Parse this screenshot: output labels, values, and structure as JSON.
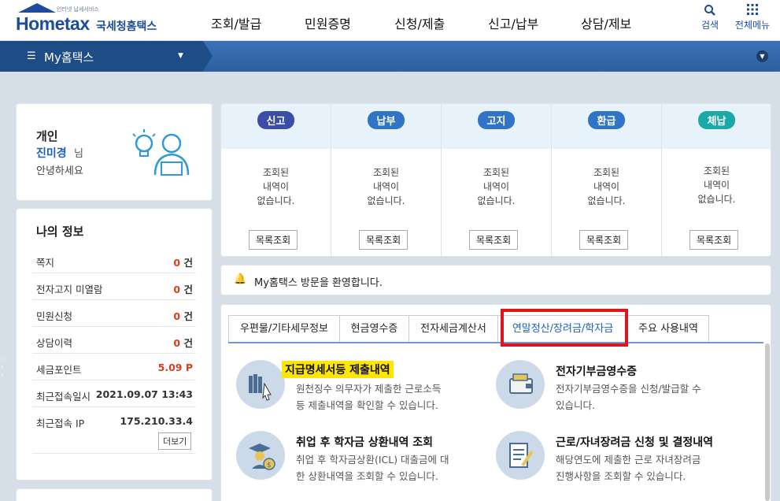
{
  "header": {
    "logo_small": "인터넷 납세서비스",
    "logo_main": "Hometax",
    "logo_ko": "국세청홈택스",
    "nav": [
      "조회/발급",
      "민원증명",
      "신청/제출",
      "신고/납부",
      "상담/제보"
    ],
    "search_label": "검색",
    "allmenu_label": "전체메뉴"
  },
  "subnav": {
    "my_label": "My홈택스"
  },
  "greeting": {
    "type": "개인",
    "name": "진미경",
    "suffix": "님",
    "hello": "안녕하세요"
  },
  "myinfo": {
    "title": "나의 정보",
    "rows": [
      {
        "label": "쪽지",
        "num": "0",
        "unit": "건"
      },
      {
        "label": "전자고지 미열람",
        "num": "0",
        "unit": "건"
      },
      {
        "label": "민원신청",
        "num": "0",
        "unit": "건"
      },
      {
        "label": "상담이력",
        "num": "0",
        "unit": "건"
      },
      {
        "label": "세금포인트",
        "num": "5.09",
        "unit": "P"
      },
      {
        "label": "최근접속일시",
        "num": "",
        "unit": "2021.09.07 13:43"
      },
      {
        "label": "최근접속 IP",
        "num": "",
        "unit": "175.210.33.4"
      }
    ],
    "more": "더보기"
  },
  "status_columns": [
    {
      "label": "신고",
      "color": "#3b4da8",
      "msg1": "조회된",
      "msg2": "내역이",
      "msg3": "없습니다.",
      "button": "목록조회"
    },
    {
      "label": "납부",
      "color": "#2f74c6",
      "msg1": "조회된",
      "msg2": "내역이",
      "msg3": "없습니다.",
      "button": "목록조회"
    },
    {
      "label": "고지",
      "color": "#2f74c6",
      "msg1": "조회된",
      "msg2": "내역이",
      "msg3": "없습니다.",
      "button": "목록조회"
    },
    {
      "label": "환급",
      "color": "#2f74c6",
      "msg1": "조회된",
      "msg2": "내역이",
      "msg3": "없습니다.",
      "button": "목록조회"
    },
    {
      "label": "체납",
      "color": "#1aa8a8",
      "msg1": "조회된",
      "msg2": "내역이",
      "msg3": "없습니다.",
      "button": "목록조회"
    }
  ],
  "notice": {
    "text": "My홈택스 방문을 환영합니다."
  },
  "tabs": [
    "우편물/기타세무정보",
    "현금영수증",
    "전자세금계산서",
    "연말정산/장려금/학자금",
    "주요 사용내역"
  ],
  "services": [
    {
      "title": "지급명세서등 제출내역",
      "line1": "원천징수 의무자가 제출한 근로소득",
      "line2": "등 제출내역을 확인할 수 있습니다.",
      "icon": "books-icon"
    },
    {
      "title": "전자기부금영수증",
      "line1": "전자기부금영수증을 신청/발급할 수",
      "line2": "있습니다.",
      "icon": "wallet-icon"
    },
    {
      "title": "취업 후 학자금 상환내역 조회",
      "line1": "취업 후 학자금상환(ICL) 대출금에 대",
      "line2": "한 상환내역을 조회할 수 있습니다.",
      "icon": "graduate-icon"
    },
    {
      "title": "근로/자녀장려금 신청 및 결정내역",
      "line1": "해당연도에 제출한 근로 자녀장려금",
      "line2": "진행사항을 조회할 수 있습니다.",
      "icon": "document-pen-icon"
    }
  ],
  "colors": {
    "brand": "#1d4c9c",
    "accent_red": "#e03a1c",
    "highlight": "#ffe600",
    "callout_border": "#e0151b"
  }
}
